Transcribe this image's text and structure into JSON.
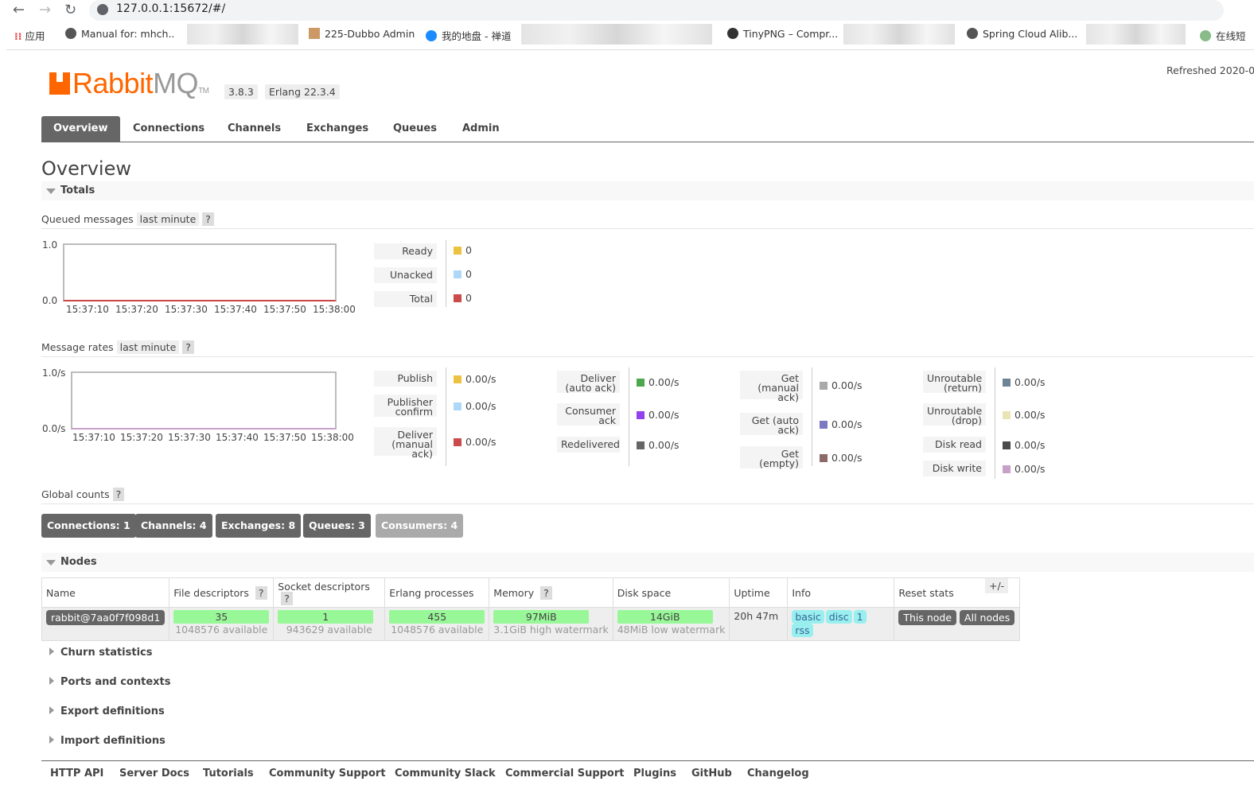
{
  "browser": {
    "url": "127.0.0.1:15672/#/",
    "bookmarks": [
      "应用",
      "Manual for: mhch..",
      "225-Dubbo Admin",
      "我的地盘 - 禅道",
      "TinyPNG – Compr...",
      "Spring Cloud Alib...",
      "在线短"
    ]
  },
  "header": {
    "logo": "RabbitMQ",
    "version": "3.8.3",
    "erlang": "Erlang 22.3.4",
    "refreshed": "Refreshed 2020-0"
  },
  "tabs": [
    "Overview",
    "Connections",
    "Channels",
    "Exchanges",
    "Queues",
    "Admin"
  ],
  "page_title": "Overview",
  "totals": {
    "title": "Totals",
    "queued": {
      "label": "Queued messages",
      "range": "last minute",
      "help": "?",
      "y_ticks": [
        "1.0",
        "0.0"
      ],
      "x_ticks": [
        "15:37:10",
        "15:37:20",
        "15:37:30",
        "15:37:40",
        "15:37:50",
        "15:38:00"
      ],
      "legend": [
        {
          "label": "Ready",
          "value": "0",
          "color": "#edc240"
        },
        {
          "label": "Unacked",
          "value": "0",
          "color": "#afd8f8"
        },
        {
          "label": "Total",
          "value": "0",
          "color": "#cb4b4b"
        }
      ]
    },
    "rates": {
      "label": "Message rates",
      "range": "last minute",
      "help": "?",
      "y_ticks": [
        "1.0/s",
        "0.0/s"
      ],
      "x_ticks": [
        "15:37:10",
        "15:37:20",
        "15:37:30",
        "15:37:40",
        "15:37:50",
        "15:38:00"
      ],
      "columns": [
        [
          {
            "label": "Publish",
            "value": "0.00/s",
            "color": "#edc240"
          },
          {
            "label": "Publisher confirm",
            "value": "0.00/s",
            "color": "#afd8f8"
          },
          {
            "label": "Deliver (manual ack)",
            "value": "0.00/s",
            "color": "#cb4b4b"
          }
        ],
        [
          {
            "label": "Deliver (auto ack)",
            "value": "0.00/s",
            "color": "#4da74d"
          },
          {
            "label": "Consumer ack",
            "value": "0.00/s",
            "color": "#9440ed"
          },
          {
            "label": "Redelivered",
            "value": "0.00/s",
            "color": "#666"
          }
        ],
        [
          {
            "label": "Get (manual ack)",
            "value": "0.00/s",
            "color": "#aaa"
          },
          {
            "label": "Get (auto ack)",
            "value": "0.00/s",
            "color": "#7c79c3"
          },
          {
            "label": "Get (empty)",
            "value": "0.00/s",
            "color": "#8d6a6a"
          }
        ],
        [
          {
            "label": "Unroutable (return)",
            "value": "0.00/s",
            "color": "#6c8494"
          },
          {
            "label": "Unroutable (drop)",
            "value": "0.00/s",
            "color": "#e8e4b4"
          },
          {
            "label": "Disk read",
            "value": "0.00/s",
            "color": "#4a4a4a"
          },
          {
            "label": "Disk write",
            "value": "0.00/s",
            "color": "#c8a0c8"
          }
        ]
      ]
    },
    "global": {
      "label": "Global counts",
      "help": "?",
      "counts": [
        "Connections: 1",
        "Channels: 4",
        "Exchanges: 8",
        "Queues: 3",
        "Consumers: 4"
      ]
    }
  },
  "nodes": {
    "title": "Nodes",
    "headers": [
      "Name",
      "File descriptors",
      "Socket descriptors",
      "Erlang processes",
      "Memory",
      "Disk space",
      "Uptime",
      "Info",
      "Reset stats"
    ],
    "help": "?",
    "toggle": "+/-",
    "row": {
      "name": "rabbit@7aa0f7f098d1",
      "fd": "35",
      "fd_sub": "1048576 available",
      "sd": "1",
      "sd_sub": "943629 available",
      "ep": "455",
      "ep_sub": "1048576 available",
      "mem": "97MiB",
      "mem_sub": "3.1GiB high watermark",
      "disk": "14GiB",
      "disk_sub": "48MiB low watermark",
      "uptime": "20h 47m",
      "info": [
        "basic",
        "disc",
        "1",
        "rss"
      ],
      "reset": [
        "This node",
        "All nodes"
      ]
    }
  },
  "collapsed": [
    "Churn statistics",
    "Ports and contexts",
    "Export definitions",
    "Import definitions"
  ],
  "footer": [
    "HTTP API",
    "Server Docs",
    "Tutorials",
    "Community Support",
    "Community Slack",
    "Commercial Support",
    "Plugins",
    "GitHub",
    "Changelog"
  ]
}
